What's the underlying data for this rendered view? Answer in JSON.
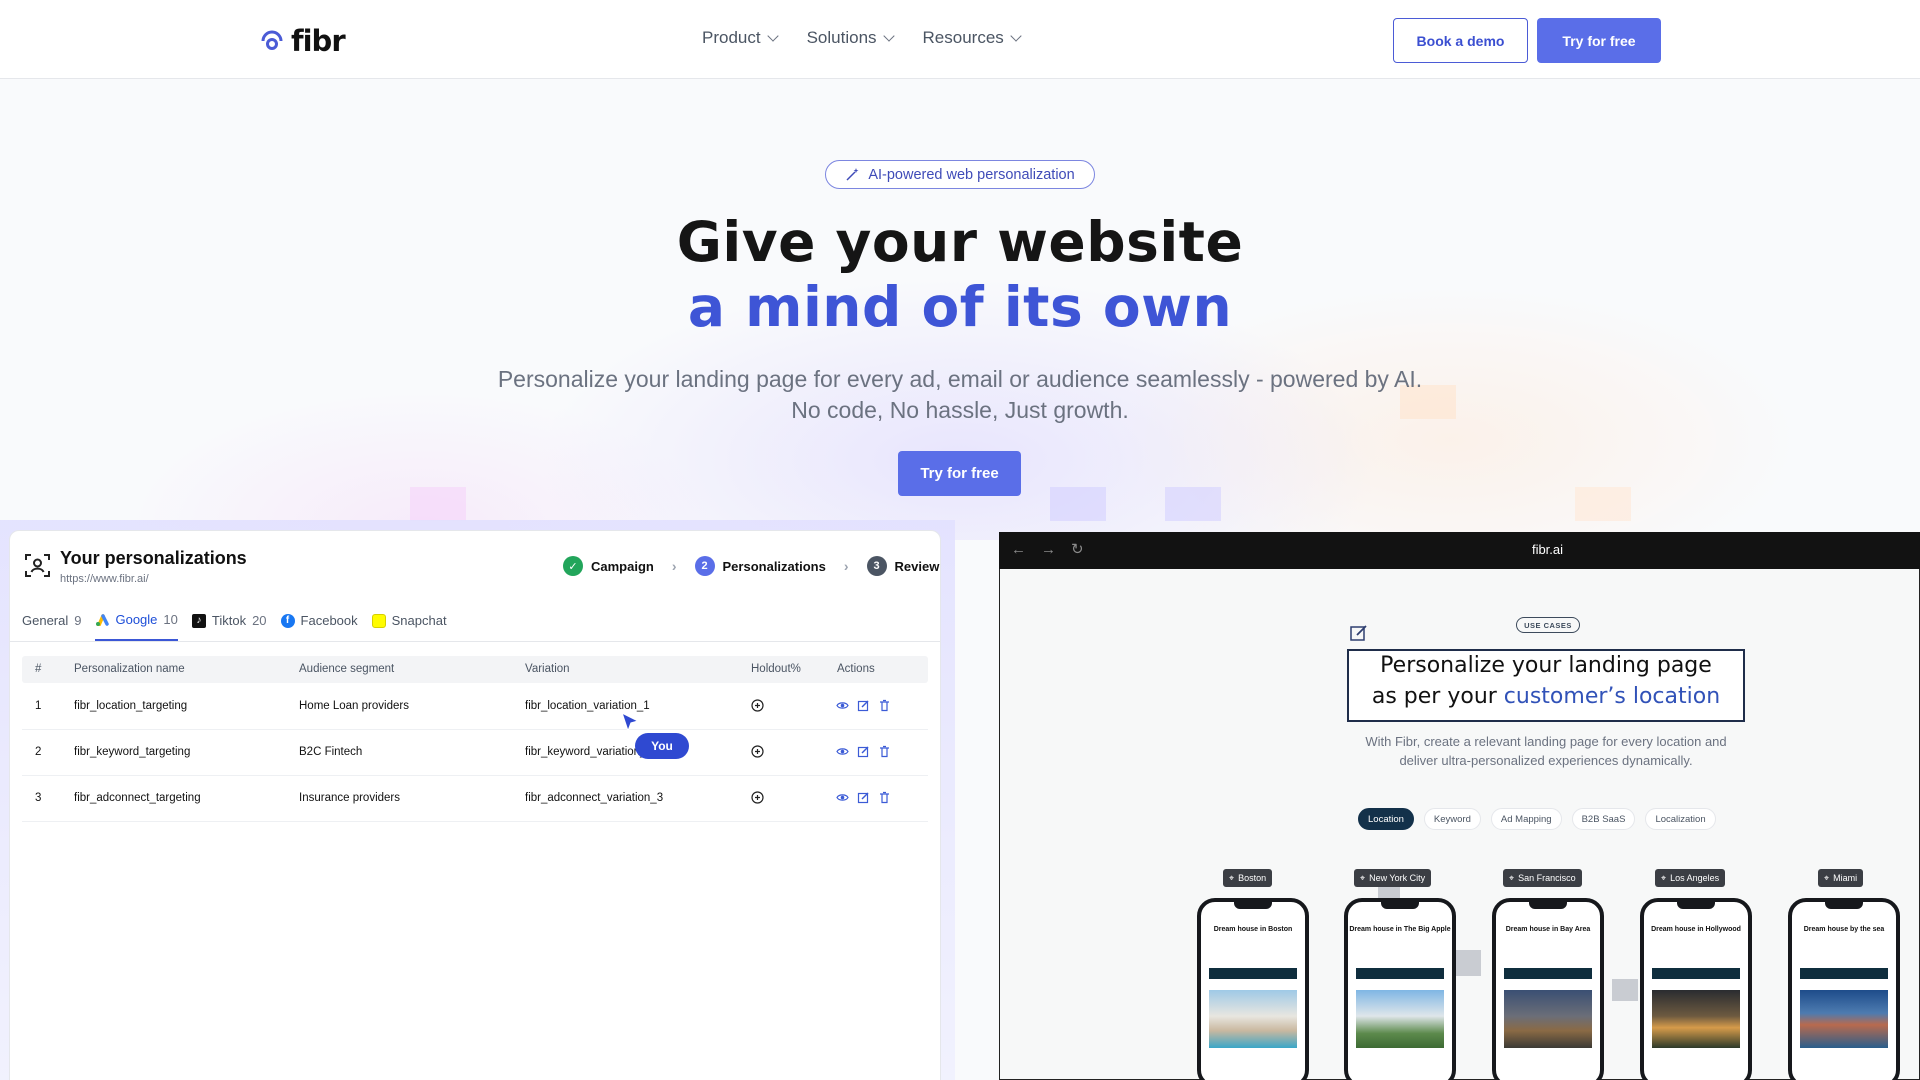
{
  "nav": {
    "logo_text": "fibr",
    "menu": [
      {
        "label": "Product"
      },
      {
        "label": "Solutions"
      },
      {
        "label": "Resources"
      }
    ],
    "book_demo": "Book a demo",
    "try_free": "Try for free"
  },
  "hero": {
    "pill": "AI-powered web personalization",
    "headline_1": "Give your website",
    "headline_2": "a mind of its own",
    "subtitle_1": "Personalize your landing page for every ad, email or audience seamlessly - powered by AI.",
    "subtitle_2": "No code, No hassle, Just growth.",
    "cta": "Try for free"
  },
  "personalizations": {
    "title": "Your personalizations",
    "url": "https://www.fibr.ai/",
    "steps": [
      {
        "num": "✓",
        "label": "Campaign",
        "color": "#22a55b"
      },
      {
        "num": "2",
        "label": "Personalizations",
        "color": "#5a6ee8"
      },
      {
        "num": "3",
        "label": "Review",
        "color": "#4b5563"
      }
    ],
    "tabs": [
      {
        "label": "General",
        "count": "9"
      },
      {
        "label": "Google",
        "count": "10"
      },
      {
        "label": "Tiktok",
        "count": "20"
      },
      {
        "label": "Facebook",
        "count": ""
      },
      {
        "label": "Snapchat",
        "count": ""
      }
    ],
    "columns": [
      "#",
      "Personalization name",
      "Audience segment",
      "Variation",
      "Holdout%",
      "Actions"
    ],
    "rows": [
      {
        "num": "1",
        "name": "fibr_location_targeting",
        "segment": "Home Loan providers",
        "variation": "fibr_location_variation_1"
      },
      {
        "num": "2",
        "name": "fibr_keyword_targeting",
        "segment": "B2C Fintech",
        "variation": "fibr_keyword_variation_2"
      },
      {
        "num": "3",
        "name": "fibr_adconnect_targeting",
        "segment": "Insurance providers",
        "variation": "fibr_adconnect_variation_3"
      }
    ],
    "cursor_label": "You"
  },
  "preview": {
    "url": "fibr.ai",
    "badge": "USE CASES",
    "heading_1": "Personalize your landing page",
    "heading_2_prefix": "as per your ",
    "heading_2_highlight": "customer’s location",
    "desc_1": "With Fibr, create a relevant landing page for every location and",
    "desc_2": "deliver ultra-personalized experiences dynamically.",
    "chips": [
      "Location",
      "Keyword",
      "Ad Mapping",
      "B2B SaaS",
      "Localization"
    ],
    "locations": [
      {
        "city": "Boston",
        "title": "Dream house in Boston"
      },
      {
        "city": "New York City",
        "title": "Dream house in The Big Apple"
      },
      {
        "city": "San Francisco",
        "title": "Dream house in Bay Area"
      },
      {
        "city": "Los Angeles",
        "title": "Dream house in Hollywood"
      },
      {
        "city": "Miami",
        "title": "Dream house by the sea"
      }
    ]
  },
  "colors": {
    "brand": "#5a6ee8",
    "headline_accent": "#3e55d6",
    "dark_navy": "#13314a"
  }
}
